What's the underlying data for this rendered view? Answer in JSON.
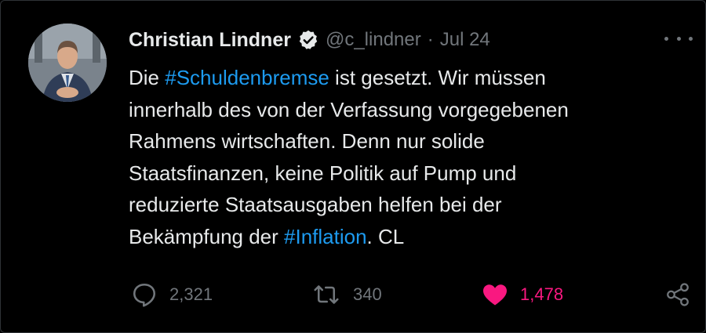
{
  "tweet": {
    "author_name": "Christian Lindner",
    "handle": "@c_lindner",
    "separator": "·",
    "date": "Jul 24",
    "text_lines": [
      {
        "before": "Die ",
        "hashtag": "#Schuldenbremse",
        "after": " ist gesetzt. Wir müssen"
      },
      {
        "text": "innerhalb des von der Verfassung vorgegebenen"
      },
      {
        "text": "Rahmens wirtschaften. Denn nur solide"
      },
      {
        "text": "Staatsfinanzen, keine Politik auf Pump und"
      },
      {
        "text": "reduzierte Staatsausgaben helfen bei der"
      },
      {
        "before": "Bekämpfung der ",
        "hashtag": "#Inflation",
        "after": ". CL"
      }
    ],
    "metrics": {
      "replies": "2,321",
      "retweets": "340",
      "likes": "1,478"
    }
  },
  "icons": {
    "avatar": "profile-photo",
    "verified": "verified-badge-icon",
    "more": "more-options-icon",
    "reply": "reply-icon",
    "retweet": "retweet-icon",
    "like": "heart-icon",
    "share": "share-icon"
  },
  "colors": {
    "background": "#000000",
    "text": "#e7e9ea",
    "secondary": "#71767b",
    "hashtag": "#1d9bf0",
    "like": "#f91880"
  }
}
